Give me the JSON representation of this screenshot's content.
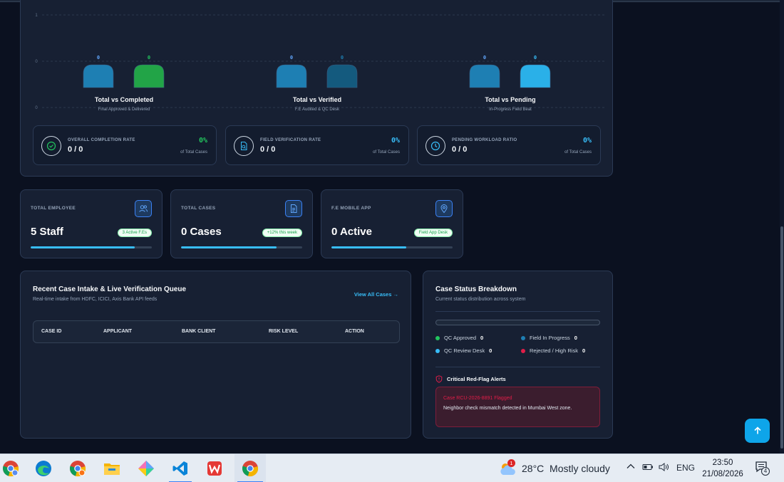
{
  "chart_data": {
    "type": "bar",
    "categories": [
      "Total vs Completed",
      "Total vs Verified",
      "Total vs Pending"
    ],
    "subtitles": [
      "Final Approved & Delivered",
      "F.E Audited & QC Desk",
      "In-Progress Field Beat"
    ],
    "series": [
      {
        "values": [
          0,
          0,
          0
        ],
        "colors": [
          "#1e7fb3",
          "#1e7fb3",
          "#1e7fb3"
        ]
      },
      {
        "values": [
          0,
          0,
          0
        ],
        "colors": [
          "#22a447",
          "#145a7e",
          "#2ab0e8"
        ]
      }
    ],
    "value_labels": [
      "0",
      "0",
      "0",
      "0",
      "0",
      "0"
    ],
    "ytick_labels": [
      "1",
      "0",
      "0"
    ],
    "ylim": [
      0,
      1
    ],
    "grid": true
  },
  "kpis": [
    {
      "label": "OVERALL COMPLETION RATE",
      "value": "0 / 0",
      "percent": "0%",
      "sub": "of Total Cases",
      "color": "#22c55e",
      "icon": "check-circle-icon"
    },
    {
      "label": "FIELD VERIFICATION RATE",
      "value": "0 / 0",
      "percent": "0%",
      "sub": "of Total Cases",
      "color": "#38bdf8",
      "icon": "document-search-icon"
    },
    {
      "label": "PENDING WORKLOAD RATIO",
      "value": "0 / 0",
      "percent": "0%",
      "sub": "of Total Cases",
      "color": "#38bdf8",
      "icon": "clock-icon"
    }
  ],
  "stats": [
    {
      "label": "TOTAL EMPLOYEE",
      "value": "5 Staff",
      "badge": "3 Active F.Es",
      "progress": 0.86,
      "icon": "users-icon"
    },
    {
      "label": "TOTAL CASES",
      "value": "0 Cases",
      "badge": "+12% this week",
      "progress": 0.79,
      "icon": "file-text-icon"
    },
    {
      "label": "F.E MOBILE APP",
      "value": "0 Active",
      "badge": "Field App Desk",
      "progress": 0.62,
      "icon": "map-pin-icon"
    }
  ],
  "queue": {
    "title": "Recent Case Intake & Live Verification Queue",
    "subtitle": "Real-time intake from HDFC, ICICI, Axis Bank API feeds",
    "link": "View All Cases →",
    "columns": [
      "CASE ID",
      "APPLICANT",
      "BANK CLIENT",
      "RISK LEVEL",
      "ACTION"
    ]
  },
  "status": {
    "title": "Case Status Breakdown",
    "subtitle": "Current status distribution across system",
    "legend": [
      {
        "label": "QC Approved",
        "count": "0",
        "color": "#22c55e"
      },
      {
        "label": "Field In Progress",
        "count": "0",
        "color": "#1e7fb3"
      },
      {
        "label": "QC Review Desk",
        "count": "0",
        "color": "#38bdf8"
      },
      {
        "label": "Rejected / High Risk",
        "count": "0",
        "color": "#e11d48"
      }
    ],
    "alerts_title": "Critical Red-Flag Alerts",
    "alert": {
      "title": "Case RCU-2026-8891 Flagged",
      "desc": "Neighbor check mismatch detected in Mumbai West zone."
    }
  },
  "taskbar": {
    "weather": "28°C  Mostly cloudy",
    "weather_badge": "1",
    "lang": "ENG",
    "time": "23:50",
    "date": "21/08/2026",
    "notifications": "4"
  }
}
